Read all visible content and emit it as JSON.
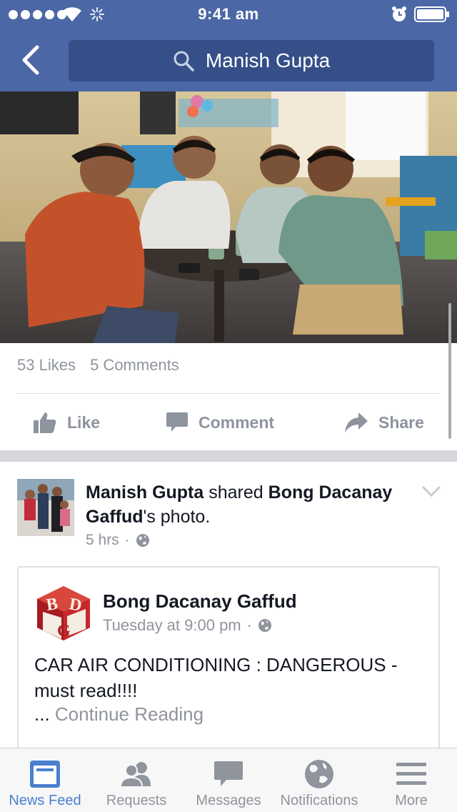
{
  "status_bar": {
    "time": "9:41 am"
  },
  "search": {
    "query": "Manish Gupta"
  },
  "post1": {
    "likes": "53 Likes",
    "comments": "5 Comments",
    "actions": {
      "like": "Like",
      "comment": "Comment",
      "share": "Share"
    }
  },
  "post2": {
    "author": "Manish Gupta",
    "verb": "shared",
    "target": "Bong Dacanay Gaffud",
    "target_suffix": "'s photo.",
    "time": "5 hrs",
    "sep": "·",
    "card": {
      "page_name": "Bong Dacanay Gaffud",
      "time": "Tuesday at 9:00 pm",
      "sep": "·",
      "text": "CAR AIR CONDITIONING : DANGEROUS - must read!!!!",
      "ellipsis": "...",
      "continue": "Continue Reading"
    }
  },
  "tabs": [
    {
      "label": "News Feed",
      "icon": "news-feed-icon",
      "active": true
    },
    {
      "label": "Requests",
      "icon": "friend-requests-icon",
      "active": false
    },
    {
      "label": "Messages",
      "icon": "messages-icon",
      "active": false
    },
    {
      "label": "Notifications",
      "icon": "globe-icon",
      "active": false
    },
    {
      "label": "More",
      "icon": "hamburger-menu-icon",
      "active": false
    }
  ],
  "colors": {
    "header": "#4b67a6",
    "search_bg": "#364f88",
    "active_tab": "#4a7fd0",
    "muted_text": "#90949c"
  }
}
